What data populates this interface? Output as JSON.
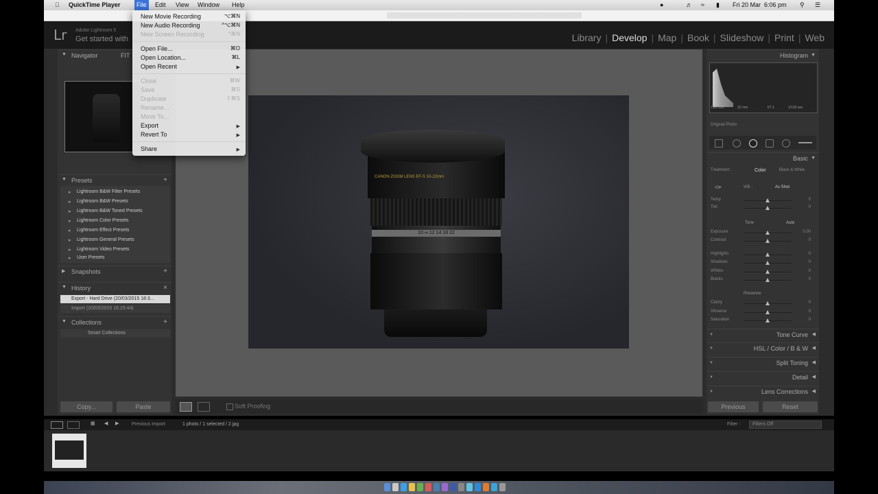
{
  "menubar": {
    "app": "QuickTime Player",
    "items": [
      "File",
      "Edit",
      "View",
      "Window",
      "Help"
    ],
    "date": "Fri 20 Mar",
    "time": "6:06 pm"
  },
  "lightroom": {
    "logo": "Lr",
    "identity_line1": "Adobe Lightroom 5",
    "identity_line2": "Get started with",
    "modules": [
      "Library",
      "Develop",
      "Map",
      "Book",
      "Slideshow",
      "Print",
      "Web"
    ],
    "active_module": "Develop"
  },
  "file_menu": {
    "items": [
      {
        "label": "New Movie Recording",
        "shortcut": "⌥⌘N",
        "disabled": false
      },
      {
        "label": "New Audio Recording",
        "shortcut": "^⌥⌘N",
        "disabled": false
      },
      {
        "label": "New Screen Recording",
        "shortcut": "^⌘N",
        "disabled": true
      },
      {
        "label": "Open File...",
        "shortcut": "⌘O",
        "disabled": false
      },
      {
        "label": "Open Location...",
        "shortcut": "⌘L",
        "disabled": false
      },
      {
        "label": "Open Recent",
        "shortcut": "",
        "disabled": false
      },
      {
        "label": "Close",
        "shortcut": "⌘W",
        "disabled": true
      },
      {
        "label": "Save",
        "shortcut": "⌘S",
        "disabled": true
      },
      {
        "label": "Duplicate",
        "shortcut": "⇧⌘S",
        "disabled": true
      },
      {
        "label": "Rename...",
        "shortcut": "",
        "disabled": true
      },
      {
        "label": "Move To...",
        "shortcut": "",
        "disabled": true
      },
      {
        "label": "Export",
        "shortcut": "",
        "disabled": false
      },
      {
        "label": "Revert To",
        "shortcut": "",
        "disabled": false
      },
      {
        "label": "Share",
        "shortcut": "",
        "disabled": false
      }
    ]
  },
  "left_panel": {
    "navigator": "Navigator",
    "nav_fit": "FIT",
    "presets_title": "Presets",
    "presets": [
      "Lightroom B&W Filter Presets",
      "Lightroom B&W Presets",
      "Lightroom B&W Toned Presets",
      "Lightroom Color Presets",
      "Lightroom Effect Presets",
      "Lightroom General Presets",
      "Lightroom Video Presets",
      "User Presets"
    ],
    "snapshots": "Snapshots",
    "history": "History",
    "history_items": [
      "Export - Hard Drive (20/03/2015 18:3...",
      "Import (20/03/2015 16:15:44)"
    ],
    "collections": "Collections",
    "collection_item": "Smart Collections",
    "copy": "Copy...",
    "paste": "Paste"
  },
  "center": {
    "soft_proofing": "Soft Proofing",
    "lens_brand_text": "CANON ZOOM LENS EF-S 10-22mm",
    "lens_scale_text": "10 ∞ 12 14 18 22"
  },
  "right_panel": {
    "histogram": "Histogram",
    "hist_info": [
      "ISO 100",
      "22 mm",
      "f/7.1",
      "1/100 sec"
    ],
    "original_photo": "Original Photo",
    "basic": "Basic",
    "treatment": "Treatment :",
    "color": "Color",
    "bw": "Black & White",
    "wb": "WB :",
    "wb_value": "As Shot",
    "temp": "Temp",
    "tint": "Tint",
    "tone": "Tone",
    "auto": "Auto",
    "exposure": "Exposure",
    "exposure_val": "0.00",
    "contrast": "Contrast",
    "highlights": "Highlights",
    "shadows": "Shadows",
    "whites": "Whites",
    "blacks": "Blacks",
    "presence": "Presence",
    "clarity": "Clarity",
    "vibrance": "Vibrance",
    "saturation": "Saturation",
    "zero": "0",
    "tone_curve": "Tone Curve",
    "hsl": "HSL  /  Color  /  B & W",
    "split_toning": "Split Toning",
    "detail": "Detail",
    "lens_corrections": "Lens Corrections",
    "previous": "Previous",
    "reset": "Reset"
  },
  "filmstrip": {
    "source": "Previous Import",
    "count": "1 photo / 1 selected / 2.jpg",
    "filter_label": "Filter :",
    "filter_value": "Filters Off"
  }
}
